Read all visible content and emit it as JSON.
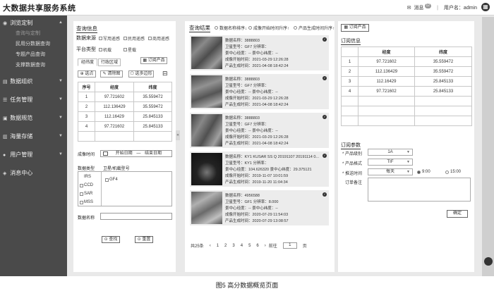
{
  "header": {
    "brand": "大数据共享服务系统",
    "messages_label": "消息",
    "messages_count": "12",
    "user_label": "用户名：admin"
  },
  "sidebar": {
    "groups": [
      {
        "label": "浏览定制",
        "subs": [
          "查询与定制",
          "民用分数据查询",
          "专题产品查询",
          "支撑数据查询"
        ]
      },
      {
        "label": "数据组织"
      },
      {
        "label": "任务管理"
      },
      {
        "label": "数据规范"
      },
      {
        "label": "海量存储"
      },
      {
        "label": "用户管理"
      },
      {
        "label": "消息中心"
      }
    ]
  },
  "query": {
    "title": "查询信息",
    "source_label": "数据来源",
    "sources": [
      "军用遥感",
      "民用遥感",
      "商用遥感"
    ],
    "platform_label": "平台类型",
    "platforms": [
      "机载",
      "星载"
    ],
    "order_product_btn": "订阅产品",
    "tabs": [
      "经纬度",
      "行政区域"
    ],
    "btn_select_point": "选点",
    "btn_clear": "清除图",
    "btn_multi_draw": "选多边形",
    "table": {
      "headers": [
        "序号",
        "经度",
        "纬度"
      ],
      "rows": [
        [
          "1",
          "97.721602",
          "35.559472"
        ],
        [
          "2",
          "112.136429",
          "35.559472"
        ],
        [
          "3",
          "112.16429",
          "25.845133"
        ],
        [
          "4",
          "97.721602",
          "25.845133"
        ]
      ]
    },
    "imaging_time_label": "成像时间",
    "start_date": "开始日期",
    "end_date": "结束日期",
    "date_sep": "—",
    "data_type_label": "数据类型",
    "satellite_label": "卫星/机载型号",
    "data_types": [
      "IRS",
      "CCD",
      "SAR",
      "MSS"
    ],
    "satellites": [
      "GF4"
    ],
    "data_name_label": "数据名称",
    "search_btn": "查找",
    "reset_btn": "重置"
  },
  "results": {
    "title": "查询结果",
    "sort_options": [
      "数据名称排序↓",
      "成像开始时间升序↑",
      "产品生成时间升序↑"
    ],
    "cards": [
      {
        "name": "数据名称：3888803",
        "sat": "卫星型号：GF7  分辨率：",
        "center": "景中心经度：--  景中心纬度：--",
        "start": "成像开始时间：2021-03-29 12:26:28",
        "gen": "产品生成时间：2021-04-08 18:42:24"
      },
      {
        "name": "数据名称：3888803",
        "sat": "卫星型号：GF7  分辨率：",
        "center": "景中心经度：--  景中心纬度：--",
        "start": "成像开始时间：2021-03-29 12:26:28",
        "gen": "产品生成时间：2021-04-08 18:42:24"
      },
      {
        "name": "数据名称：3888803",
        "sat": "卫星型号：GF7  分辨率：",
        "center": "景中心经度：--  景中心纬度：--",
        "start": "成像开始时间：2021-03-29 12:26:28",
        "gen": "产品生成时间：2021-04-08 18:42:24"
      },
      {
        "name": "数据名称：KY1 KUSAR SS Q 20191107 20191114 0...",
        "sat": "卫星型号：KY1  分辨率：",
        "center": "景中心经度：104.626320  景中心纬度：29.375121",
        "start": "成像开始时间：2019-11-07 10:01:59",
        "gen": "产品生成时间：2019-11-20 11:04:34"
      },
      {
        "name": "数据名称：4956588",
        "sat": "卫星型号：GF1  分辨率：8.000",
        "center": "景中心经度：--  景中心纬度：--",
        "start": "成像开始时间：2020-07-29 11:54:03",
        "gen": "产品生成时间：2020-07-29 13:08:57"
      }
    ],
    "pager": {
      "total": "共25条",
      "pages": [
        "1",
        "2",
        "3",
        "4",
        "5",
        "6"
      ],
      "goto_label": "前往",
      "goto_value": "1",
      "page_suffix": "页"
    }
  },
  "order": {
    "btn": "订阅产品",
    "info_title": "订阅信息",
    "table": {
      "headers": [
        "",
        "经度",
        "纬度"
      ],
      "rows": [
        [
          "1",
          "97.721602",
          "35.559472"
        ],
        [
          "2",
          "112.136429",
          "35.559472"
        ],
        [
          "3",
          "112.16429",
          "25.845133"
        ],
        [
          "4",
          "97.721602",
          "25.845133"
        ]
      ]
    },
    "params_title": "订阅参数",
    "level_label": "* 产品级别",
    "level_value": "1A",
    "format_label": "* 产品格式",
    "format_value": "TIF",
    "push_label": "* 推送时间",
    "push_value": "每天",
    "time_options": [
      "9:00",
      "15:00"
    ],
    "note_label": "订单备注",
    "ok_btn": "确定"
  },
  "caption": "图5  高分数据概览页面"
}
